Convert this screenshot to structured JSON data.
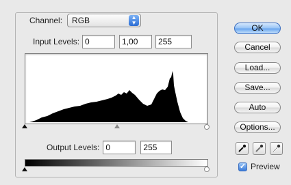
{
  "channel": {
    "label": "Channel:",
    "value": "RGB"
  },
  "input_levels": {
    "label": "Input Levels:",
    "black": "0",
    "gamma": "1,00",
    "white": "255"
  },
  "output_levels": {
    "label": "Output Levels:",
    "black": "0",
    "white": "255"
  },
  "buttons": {
    "ok": "OK",
    "cancel": "Cancel",
    "load": "Load...",
    "save": "Save...",
    "auto": "Auto",
    "options": "Options..."
  },
  "preview": {
    "label": "Preview",
    "checked": true
  },
  "icons": {
    "channel_select": "up-down-arrows-icon",
    "eyedropper_black": "black-eyedropper-icon",
    "eyedropper_gray": "gray-eyedropper-icon",
    "eyedropper_white": "white-eyedropper-icon"
  },
  "colors": {
    "default_button": "#6aa6ef",
    "accent": "#3a7ad8"
  }
}
